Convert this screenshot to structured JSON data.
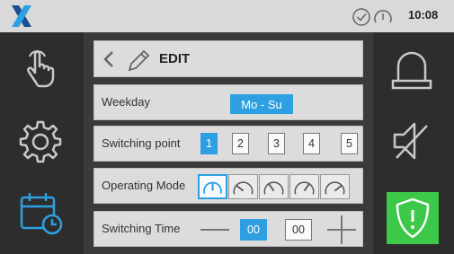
{
  "header": {
    "time": "10:08",
    "status_icons": [
      "check-circle-icon",
      "gauge-icon"
    ]
  },
  "sidebar_left": {
    "items": [
      {
        "name": "touch",
        "icon": "hand-pointer-icon"
      },
      {
        "name": "settings",
        "icon": "gear-icon"
      },
      {
        "name": "schedule",
        "icon": "calendar-clock-icon",
        "active": true
      }
    ]
  },
  "sidebar_right": {
    "items": [
      {
        "name": "alarm",
        "icon": "siren-icon"
      },
      {
        "name": "mute",
        "icon": "speaker-muted-icon"
      },
      {
        "name": "warning",
        "icon": "shield-alert-icon",
        "active": true
      }
    ]
  },
  "edit": {
    "title": "EDIT"
  },
  "weekday": {
    "label": "Weekday",
    "value": "Mo - Su"
  },
  "switching_point": {
    "label": "Switching point",
    "options": [
      "1",
      "2",
      "3",
      "4",
      "5"
    ],
    "selected": "1"
  },
  "operating_mode": {
    "label": "Operating Mode",
    "selected_index": 0
  },
  "switching_time": {
    "label": "Switching Time",
    "hours": "00",
    "minutes": "00"
  },
  "colors": {
    "accent": "#2e9fe0",
    "success": "#3cc94a",
    "background": "#2b2b2b",
    "panel": "#dcdcdc"
  }
}
